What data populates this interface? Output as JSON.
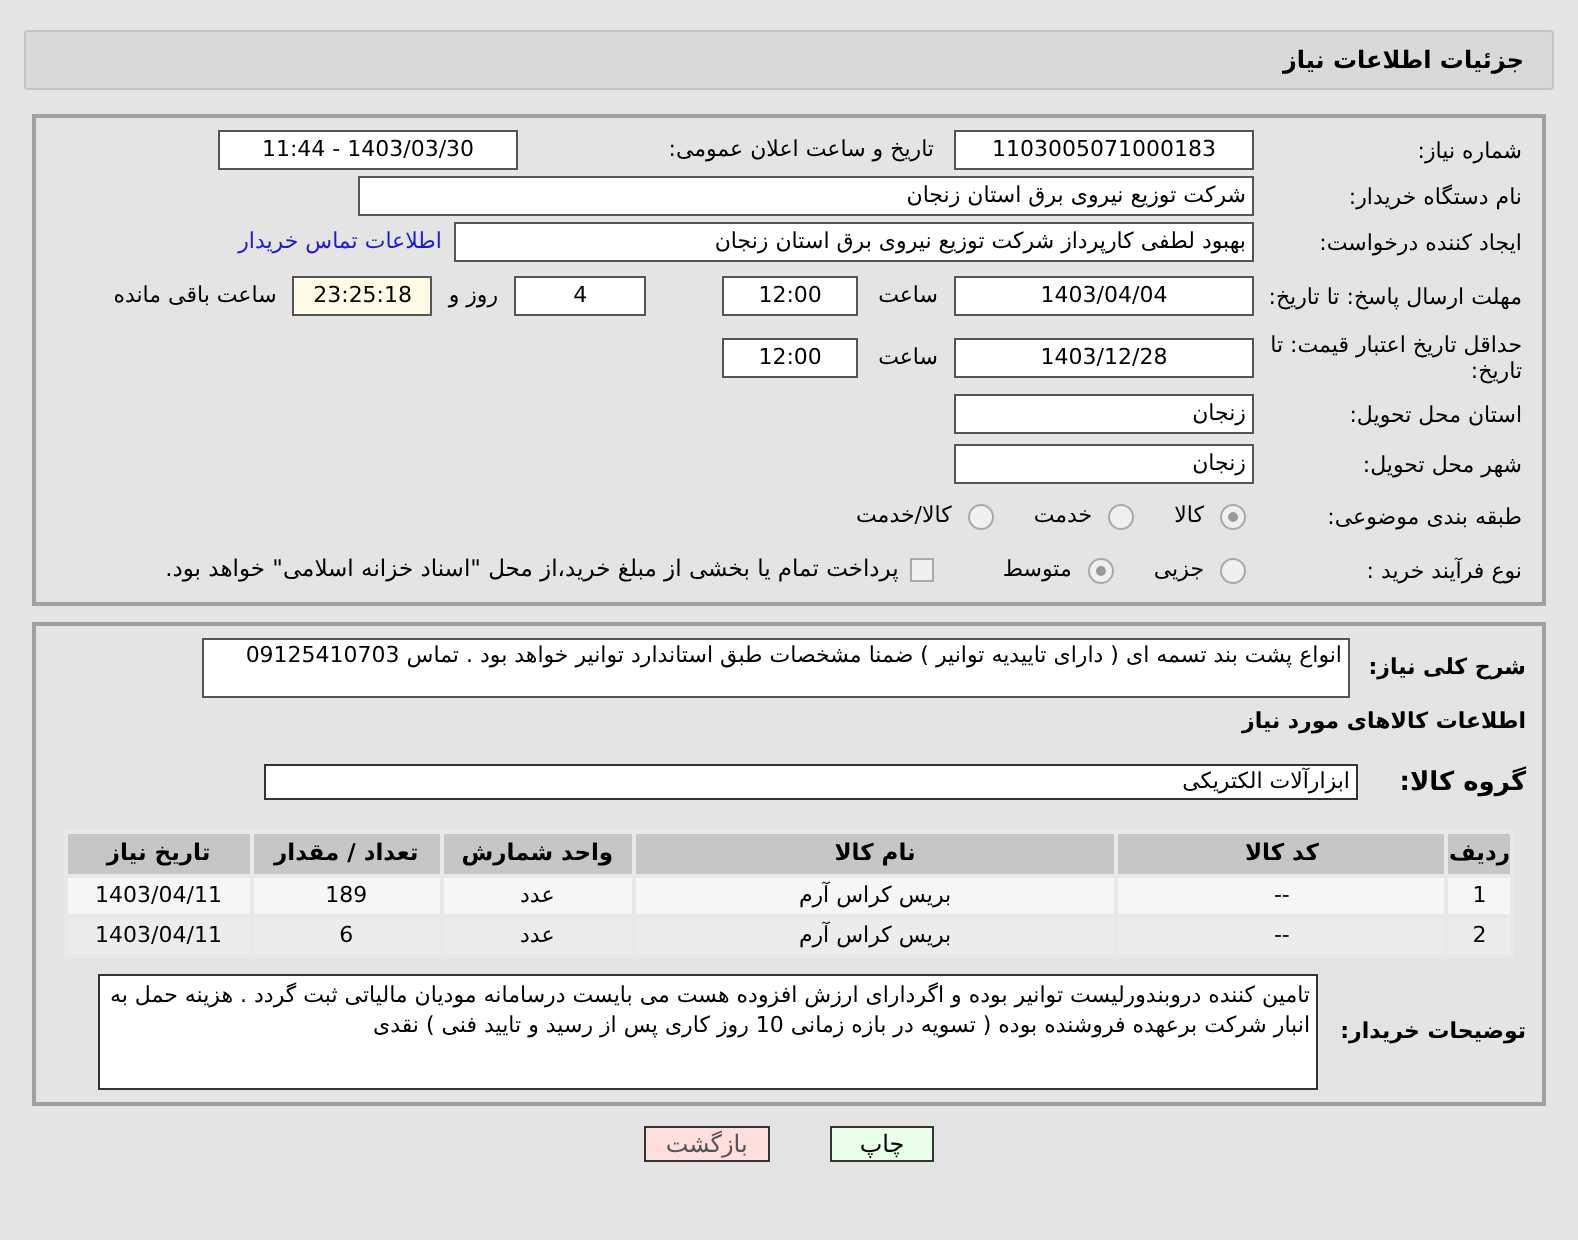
{
  "header": {
    "title": "جزئیات اطلاعات نیاز"
  },
  "need_number": {
    "label": "شماره نیاز:",
    "value": "1103005071000183"
  },
  "announce": {
    "label": "تاریخ و ساعت اعلان عمومی:",
    "value": "1403/03/30 - 11:44"
  },
  "buyer_org": {
    "label": "نام دستگاه خریدار:",
    "value": "شرکت توزیع نیروی برق استان زنجان"
  },
  "requester": {
    "label": "ایجاد کننده درخواست:",
    "value": "بهبود لطفی کارپرداز شرکت توزیع نیروی برق استان زنجان",
    "link": "اطلاعات تماس خریدار"
  },
  "reply_deadline": {
    "label": "مهلت ارسال پاسخ: تا تاریخ:",
    "date": "1403/04/04",
    "time_label": "ساعت",
    "time": "12:00",
    "days": "4",
    "days_label": "روز و",
    "remaining": "23:25:18",
    "remaining_label": "ساعت باقی مانده"
  },
  "price_validity": {
    "label": "حداقل تاریخ اعتبار قیمت: تا تاریخ:",
    "date": "1403/12/28",
    "time_label": "ساعت",
    "time": "12:00"
  },
  "province": {
    "label": "استان محل تحویل:",
    "value": "زنجان"
  },
  "city": {
    "label": "شهر محل تحویل:",
    "value": "زنجان"
  },
  "category": {
    "label": "طبقه بندی موضوعی:",
    "options": [
      {
        "label": "کالا",
        "selected": true
      },
      {
        "label": "خدمت",
        "selected": false
      },
      {
        "label": "کالا/خدمت",
        "selected": false
      }
    ]
  },
  "process": {
    "label": "نوع فرآیند خرید :",
    "options": [
      {
        "label": "جزیی",
        "selected": false
      },
      {
        "label": "متوسط",
        "selected": true
      }
    ],
    "payment": {
      "checked": false,
      "text": "پرداخت تمام یا بخشی از مبلغ خرید،از محل \"اسناد خزانه اسلامی\" خواهد بود."
    }
  },
  "description": {
    "label": "شرح کلی نیاز:",
    "value": "انواع پشت بند تسمه ای ( دارای تاییدیه توانیر ) ضمنا مشخصات طبق استاندارد توانیر خواهد بود . تماس 09125410703"
  },
  "goods_heading": "اطلاعات کالاهای مورد نیاز",
  "goods_group": {
    "label": "گروه کالا:",
    "value": "ابزارآلات الکتریکی"
  },
  "table": {
    "columns": [
      "ردیف",
      "کد کالا",
      "نام کالا",
      "واحد شمارش",
      "تعداد / مقدار",
      "تاریخ نیاز"
    ],
    "rows": [
      [
        "1",
        "--",
        "بریس کراس آرم",
        "عدد",
        "189",
        "1403/04/11"
      ],
      [
        "2",
        "--",
        "بریس کراس آرم",
        "عدد",
        "6",
        "1403/04/11"
      ]
    ]
  },
  "buyer_notes": {
    "label": "توضیحات خریدار:",
    "value": "تامین کننده دروبندورلیست توانیر بوده و اگردارای ارزش افزوده هست می بایست درسامانه مودیان مالیاتی ثبت گردد . هزینه حمل به انبار شرکت برعهده فروشنده بوده ( تسویه در بازه زمانی 10 روز کاری پس از رسید و تایید فنی ) نقدی"
  },
  "buttons": [
    {
      "kind": "print",
      "label": "چاپ"
    },
    {
      "kind": "back",
      "label": "بازگشت"
    }
  ]
}
